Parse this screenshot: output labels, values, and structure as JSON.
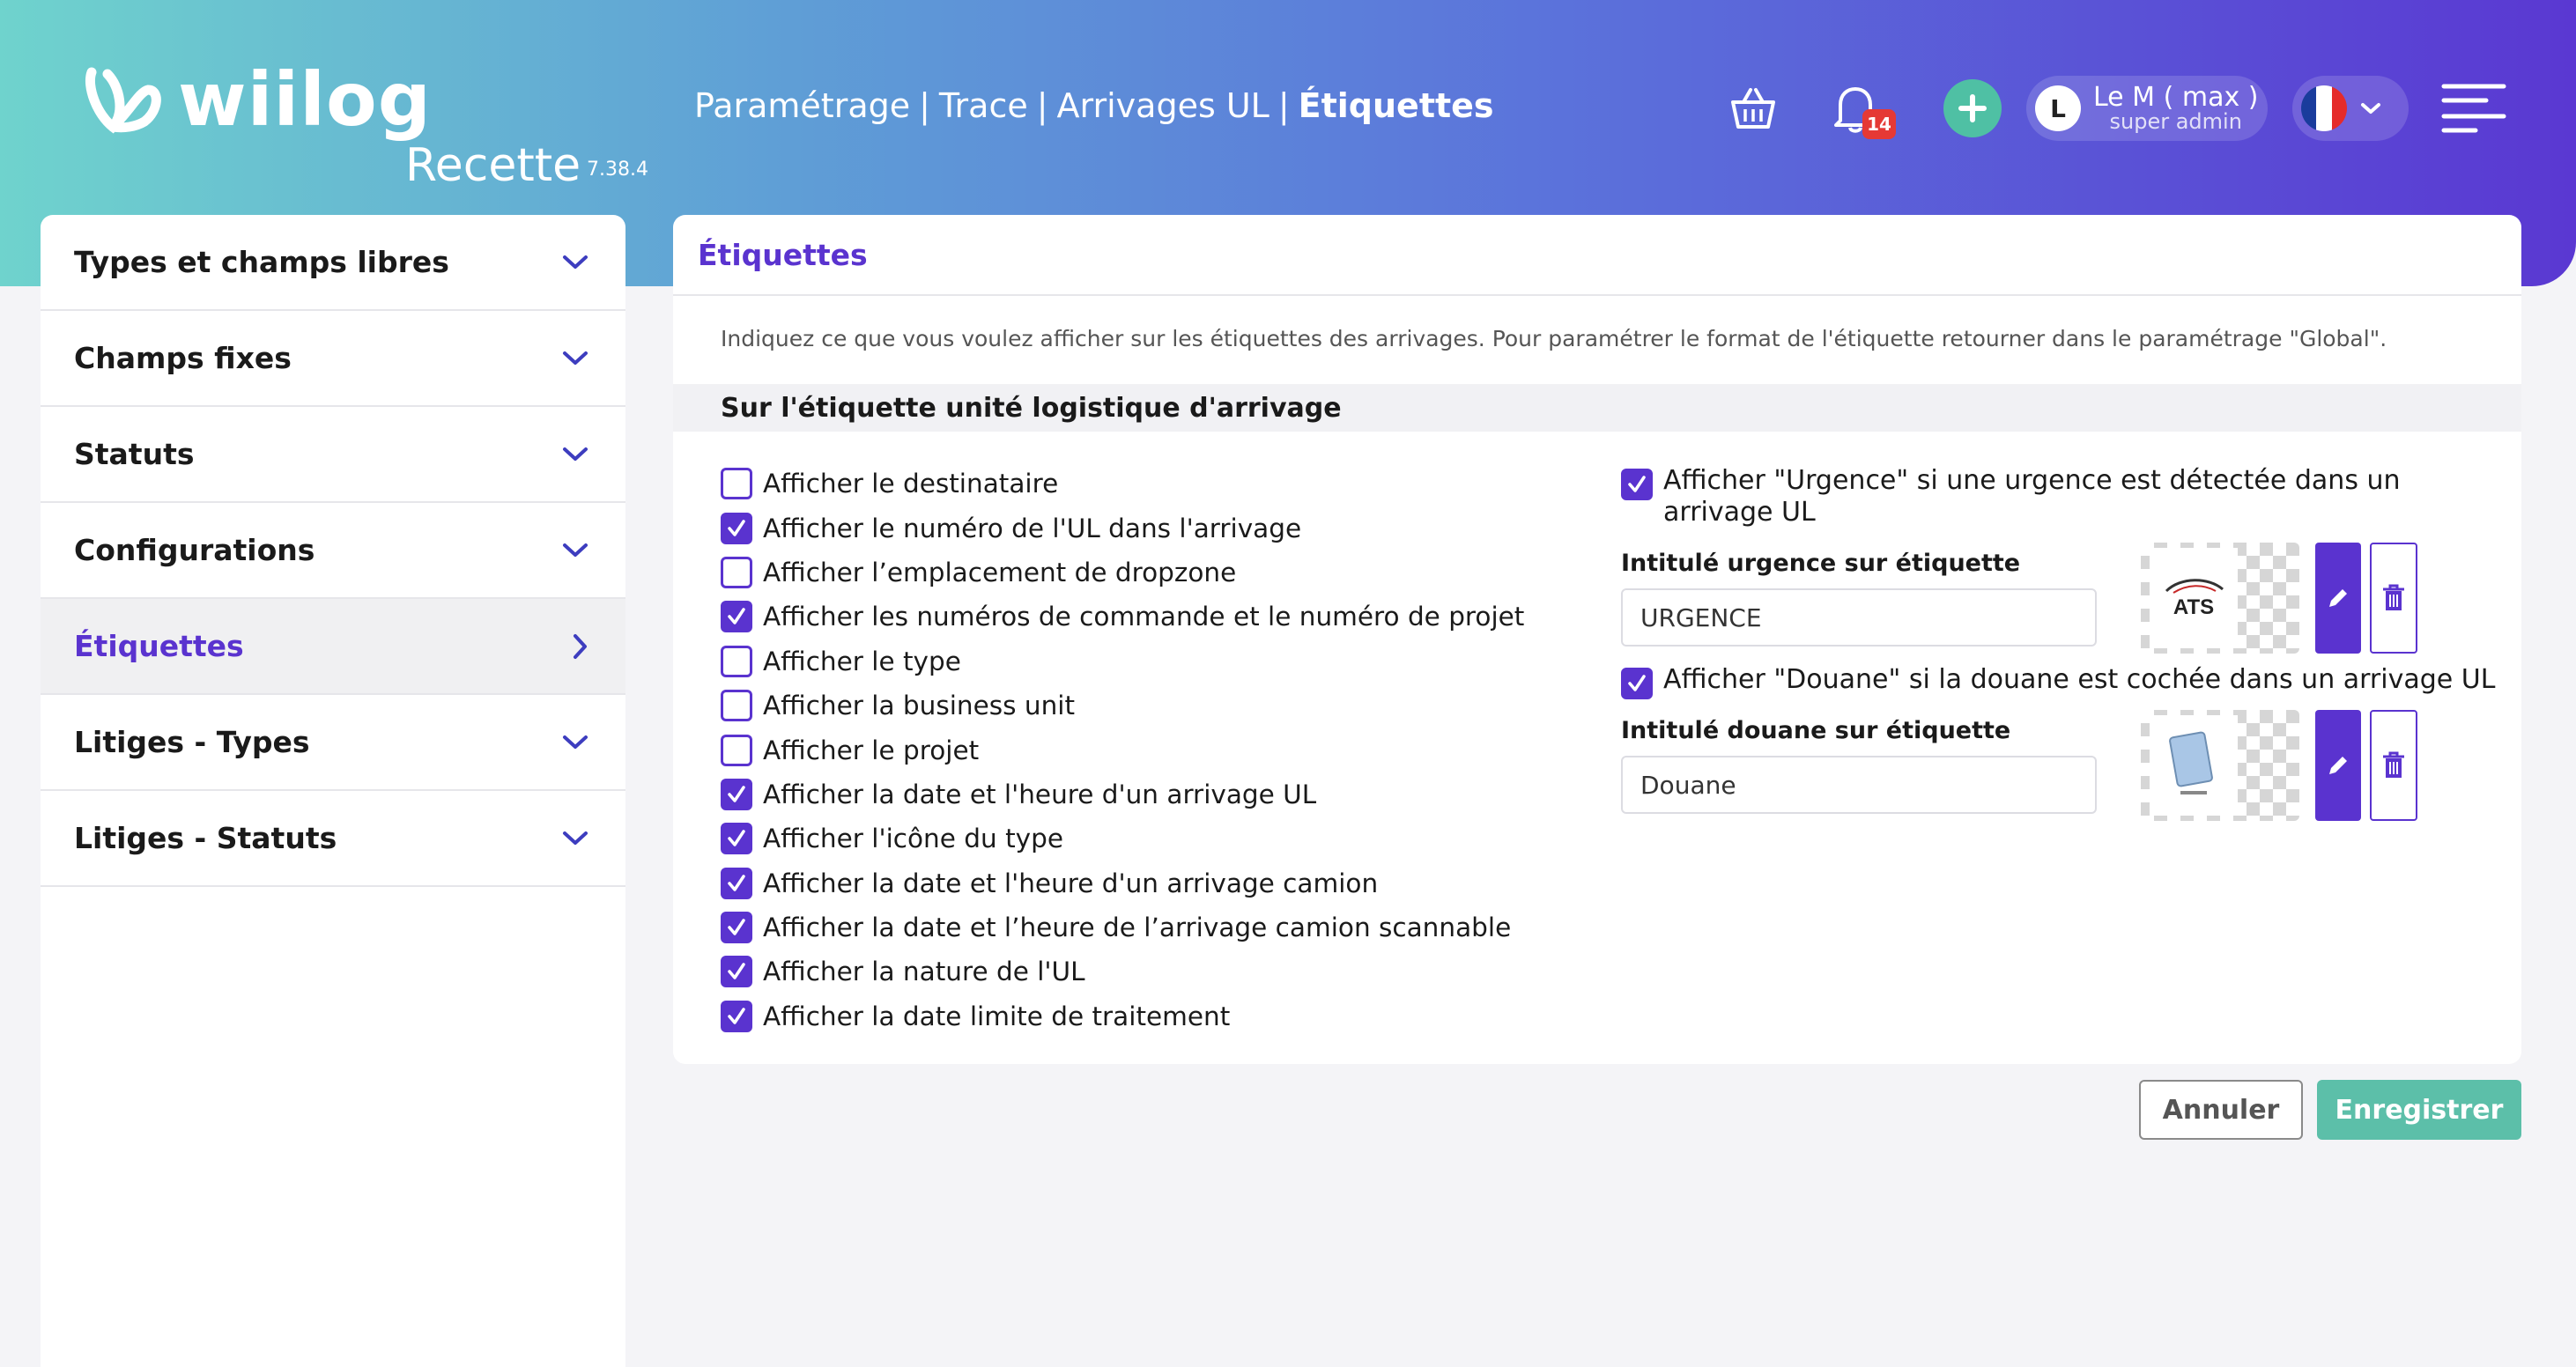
{
  "app": {
    "logo_text": "wiilog",
    "environment": "Recette",
    "version": "7.38.4"
  },
  "breadcrumb": {
    "items": [
      "Paramétrage",
      "Trace",
      "Arrivages UL"
    ],
    "separator": "|",
    "current": "Étiquettes"
  },
  "header": {
    "notification_count": "14",
    "user_initial": "L",
    "user_name": "Le M ( max )",
    "user_role": "super admin",
    "language_flag": "fr-flag-icon"
  },
  "sidebar": {
    "items": [
      {
        "label": "Types et champs libres",
        "icon": "chevron-down-icon"
      },
      {
        "label": "Champs fixes",
        "icon": "chevron-down-icon"
      },
      {
        "label": "Statuts",
        "icon": "chevron-down-icon"
      },
      {
        "label": "Configurations",
        "icon": "chevron-down-icon"
      },
      {
        "label": "Étiquettes",
        "icon": "chevron-right-icon",
        "active": true
      },
      {
        "label": "Litiges - Types",
        "icon": "chevron-down-icon"
      },
      {
        "label": "Litiges - Statuts",
        "icon": "chevron-down-icon"
      }
    ]
  },
  "panel": {
    "title": "Étiquettes",
    "description": "Indiquez ce que vous voulez afficher sur les étiquettes des arrivages. Pour paramétrer le format de l'étiquette retourner dans le paramétrage \"Global\".",
    "section_title": "Sur l'étiquette unité logistique d'arrivage",
    "checkboxes": [
      {
        "label": "Afficher le destinataire",
        "checked": false
      },
      {
        "label": "Afficher le numéro de l'UL dans l'arrivage",
        "checked": true
      },
      {
        "label": "Afficher l’emplacement de dropzone",
        "checked": false
      },
      {
        "label": "Afficher les numéros de commande et le numéro de projet",
        "checked": true
      },
      {
        "label": "Afficher le type",
        "checked": false
      },
      {
        "label": "Afficher la business unit",
        "checked": false
      },
      {
        "label": "Afficher le projet",
        "checked": false
      },
      {
        "label": "Afficher la date et l'heure d'un arrivage UL",
        "checked": true
      },
      {
        "label": "Afficher l'icône du type",
        "checked": true
      },
      {
        "label": "Afficher la date et l'heure d'un arrivage camion",
        "checked": true
      },
      {
        "label": "Afficher la date et l’heure de l’arrivage camion scannable",
        "checked": true
      },
      {
        "label": "Afficher la nature de l'UL",
        "checked": true
      },
      {
        "label": "Afficher la date limite de traitement",
        "checked": true
      }
    ],
    "urgence": {
      "checkbox_label": "Afficher \"Urgence\" si une urgence est détectée dans un arrivage UL",
      "checked": true,
      "field_label": "Intitulé urgence sur étiquette",
      "value": "URGENCE",
      "image_text": "ATS"
    },
    "douane": {
      "checkbox_label": "Afficher \"Douane\" si la douane est cochée dans un arrivage UL",
      "checked": true,
      "field_label": "Intitulé douane sur étiquette",
      "value": "Douane"
    }
  },
  "actions": {
    "cancel_label": "Annuler",
    "save_label": "Enregistrer"
  },
  "colors": {
    "accent": "#5a33cf",
    "save": "#5cbfa9",
    "badge": "#e53935"
  }
}
